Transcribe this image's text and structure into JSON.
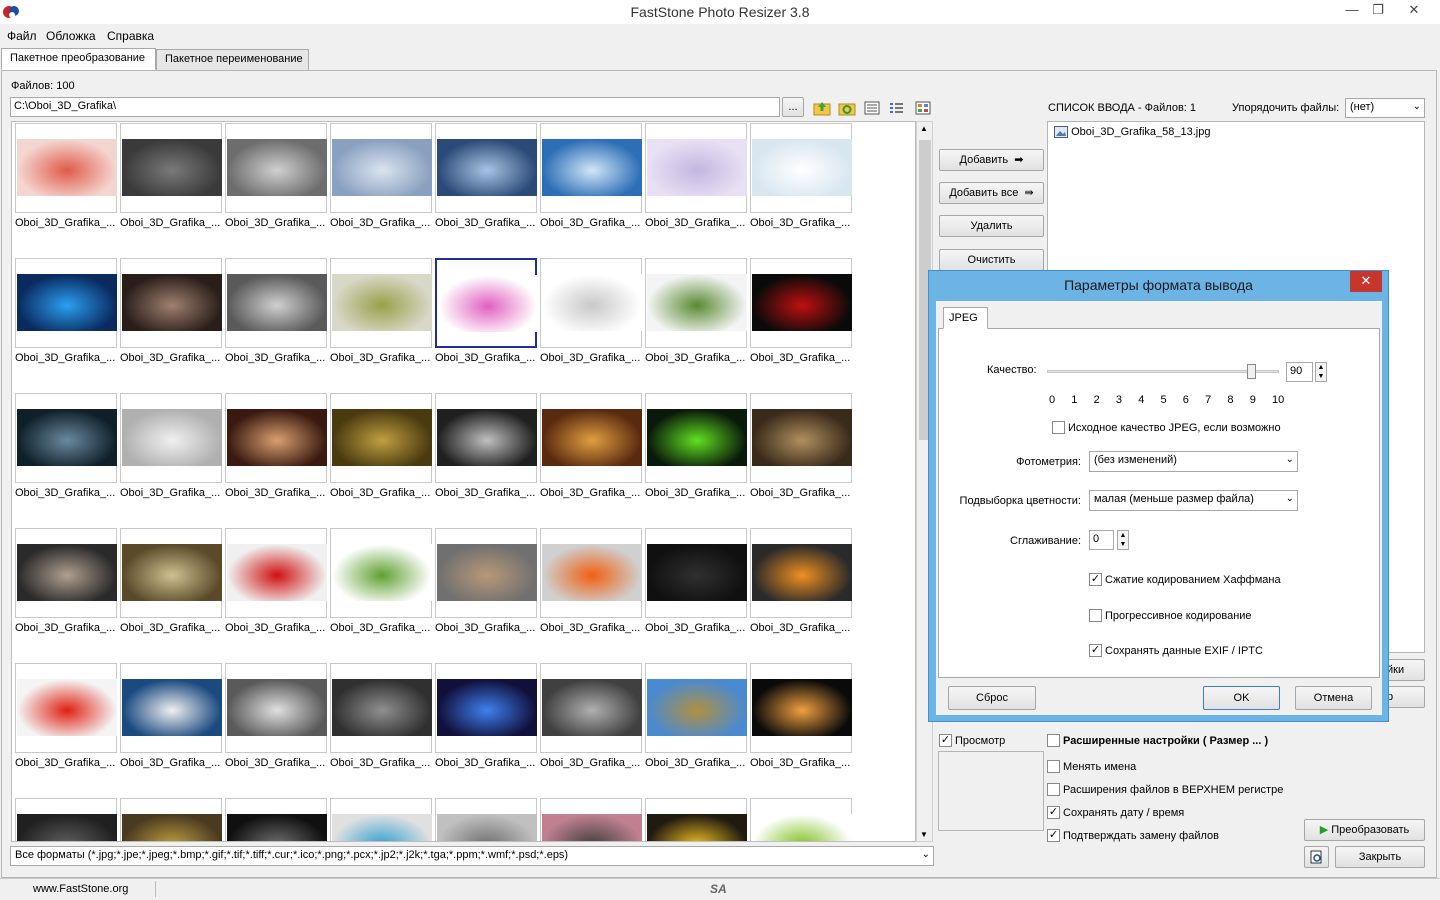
{
  "window": {
    "title": "FastStone Photo Resizer 3.8",
    "minimize": "—",
    "restore": "❐",
    "close": "✕"
  },
  "menu": [
    "Файл",
    "Обложка",
    "Справка"
  ],
  "tabs": [
    "Пакетное преобразование",
    "Пакетное переименование"
  ],
  "files_count": "Файлов: 100",
  "path": "C:\\Oboi_3D_Grafika\\",
  "browse_label": "...",
  "thumbnails": {
    "caption": "Oboi_3D_Grafika_...",
    "selected_index": 12,
    "row_count": 6,
    "per_row": 8
  },
  "filter": "Все форматы (*.jpg;*.jpe;*.jpeg;*.bmp;*.gif;*.tif;*.tiff;*.cur;*.ico;*.png;*.pcx;*.jp2;*.j2k;*.tga;*.ppm;*.wmf;*.psd;*.eps)",
  "actions": {
    "add": "Добавить",
    "add_all": "Добавить все",
    "remove": "Удалить",
    "clear": "Очистить"
  },
  "input_list": {
    "header": "СПИСОК ВВОДА  -  Файлов: 1",
    "sort_label": "Упорядочить файлы:",
    "sort_value": "(нет)",
    "items": [
      "Oboi_3D_Grafika_58_13.jpg"
    ]
  },
  "partial_buttons": [
    "йки",
    "р"
  ],
  "preview_label": "Просмотр",
  "options": {
    "advanced": "Расширенные настройки ( Размер ... )",
    "rename": "Менять имена",
    "uppercase": "Расширения файлов в ВЕРХНЕМ регистре",
    "keep_date": "Сохранять дату / время",
    "confirm": "Подтверждать замену файлов"
  },
  "convert_label": "Преобразовать",
  "close_label": "Закрыть",
  "status": {
    "site": "www.FastStone.org",
    "code": "SA"
  },
  "dialog": {
    "title": "Параметры формата вывода",
    "tab": "JPEG",
    "quality_label": "Качество:",
    "quality_value": "90",
    "quality_fraction": 0.9,
    "scale": [
      "0",
      "1",
      "2",
      "3",
      "4",
      "5",
      "6",
      "7",
      "8",
      "9",
      "10"
    ],
    "orig_quality": "Исходное качество JPEG, если возможно",
    "photometry_label": "Фотометрия:",
    "photometry_value": "(без изменений)",
    "subsampling_label": "Подвыборка цветности:",
    "subsampling_value": "малая (меньше размер файла)",
    "smoothing_label": "Сглаживание:",
    "smoothing_value": "0",
    "huffman": "Сжатие кодированием Хаффмана",
    "progressive": "Прогрессивное кодирование",
    "exif": "Сохранять данные EXIF / IPTC",
    "reset": "Сброс",
    "ok": "OK",
    "cancel": "Отмена"
  }
}
